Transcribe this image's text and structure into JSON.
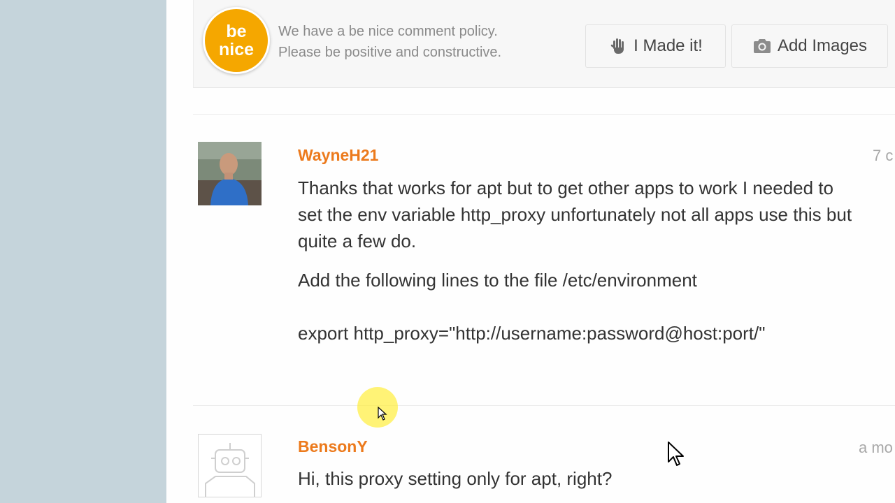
{
  "policy": {
    "badge_line1": "be",
    "badge_line2": "nice",
    "line1": "We have a be nice comment policy.",
    "line2": "Please be positive and constructive.",
    "made_it_label": "I Made it!",
    "made_it_icon": "hand-icon",
    "add_images_label": "Add Images",
    "add_images_icon": "camera-icon"
  },
  "comments": [
    {
      "author": "WayneH21",
      "time": "7 c",
      "avatar": "user-photo-avatar",
      "paragraphs": [
        "Thanks that works for apt but to get other apps to work I needed to set the env variable http_proxy unfortunately not all apps use this but quite a few do.",
        "Add the following lines to the file /etc/environment",
        "export http_proxy=\"http://username:password@host:port/\""
      ]
    },
    {
      "author": "BensonY",
      "time": "a mo",
      "avatar": "robot-avatar",
      "paragraphs": [
        "Hi, this proxy setting only for apt, right?"
      ]
    }
  ],
  "colors": {
    "accent": "#ec7a1c",
    "badge": "#f5a700",
    "sidebar": "#c5d4db"
  }
}
